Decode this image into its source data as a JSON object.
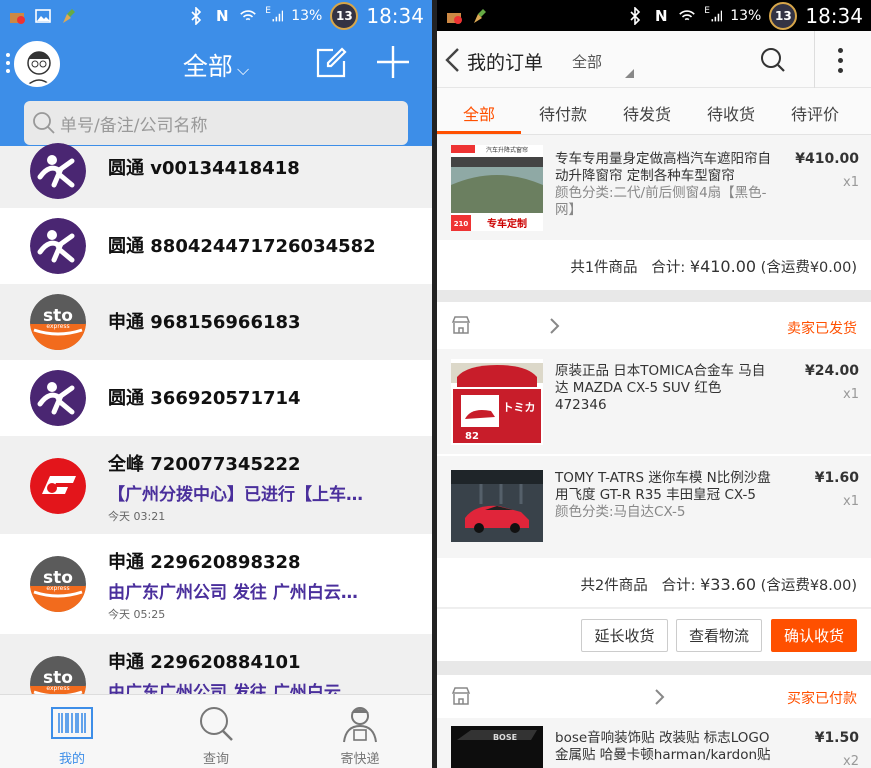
{
  "status_bar": {
    "battery_percent": "13%",
    "battery_badge": "13",
    "time": "18:34",
    "network": "E"
  },
  "left": {
    "header": {
      "title": "全部"
    },
    "search": {
      "placeholder": "单号/备注/公司名称"
    },
    "rows": [
      {
        "carrier": "yto",
        "number": "圆通 v00134418418",
        "status": "",
        "time": ""
      },
      {
        "carrier": "yto",
        "number": "圆通 880424471726034582",
        "status": "",
        "time": ""
      },
      {
        "carrier": "sto",
        "number": "申通 968156966183",
        "status": "",
        "time": ""
      },
      {
        "carrier": "yto",
        "number": "圆通 366920571714",
        "status": "",
        "time": ""
      },
      {
        "carrier": "qf",
        "number": "全峰 720077345222",
        "status": "【广州分拨中心】已进行【上车…",
        "time": "今天 03:21"
      },
      {
        "carrier": "sto",
        "number": "申通 229620898328",
        "status": "由广东广州公司 发往 广州白云…",
        "time": "今天 05:25"
      },
      {
        "carrier": "sto",
        "number": "申通 229620884101",
        "status": "由广东广州公司 发往 广州白云…",
        "time": ""
      }
    ],
    "logo_text": {
      "sto_big": "sto",
      "sto_small": "express"
    },
    "tabbar": [
      {
        "label": "我的",
        "active": true
      },
      {
        "label": "查询",
        "active": false
      },
      {
        "label": "寄快递",
        "active": false
      }
    ]
  },
  "right": {
    "header": {
      "title": "我的订单",
      "filter": "全部"
    },
    "tabs": [
      {
        "label": "全部",
        "active": true
      },
      {
        "label": "待付款"
      },
      {
        "label": "待发货"
      },
      {
        "label": "待收货"
      },
      {
        "label": "待评价"
      }
    ],
    "order1": {
      "item": {
        "title": "专车专用量身定做高档汽车遮阳帘自动升降窗帘 定制各种车型窗帘",
        "attr": "颜色分类:二代/前后侧窗4扇【黑色-网】",
        "price": "¥410.00",
        "qty": "x1",
        "thumb_caption": "汽车升降式窗帘",
        "thumb_badge": "专车定制",
        "thumb_num": "210"
      },
      "summary": {
        "count": "共1件商品",
        "total_label": "合计:",
        "total": "¥410.00",
        "shipping": "(含运费¥0.00)"
      }
    },
    "order2": {
      "status": "卖家已发货",
      "items": [
        {
          "title": "原装正品 日本TOMICA合金车 马自达 MAZDA CX-5 SUV 红色 472346",
          "attr": "",
          "price": "¥24.00",
          "qty": "x1",
          "thumb_brand": "トミカ",
          "thumb_num": "82"
        },
        {
          "title": "TOMY T-ATRS 迷你车模 N比例沙盘用飞度 GT-R R35 丰田皇冠 CX-5",
          "attr": "颜色分类:马自达CX-5",
          "price": "¥1.60",
          "qty": "x1"
        }
      ],
      "summary": {
        "count": "共2件商品",
        "total_label": "合计:",
        "total": "¥33.60",
        "shipping": "(含运费¥8.00)"
      },
      "buttons": {
        "extend": "延长收货",
        "logistics": "查看物流",
        "confirm": "确认收货"
      }
    },
    "order3": {
      "status": "买家已付款",
      "item": {
        "title": "bose音响装饰贴 改装贴 标志LOGO 金属贴 哈曼卡顿harman/kardon贴",
        "price": "¥1.50",
        "qty": "x2",
        "thumb_text": "BOSE"
      }
    }
  },
  "colors": {
    "blue": "#3d8ee8",
    "orange": "#ff5000",
    "yto_purple": "#4a2672",
    "sto_orange": "#f26b1d",
    "qf_red": "#e3151b"
  }
}
